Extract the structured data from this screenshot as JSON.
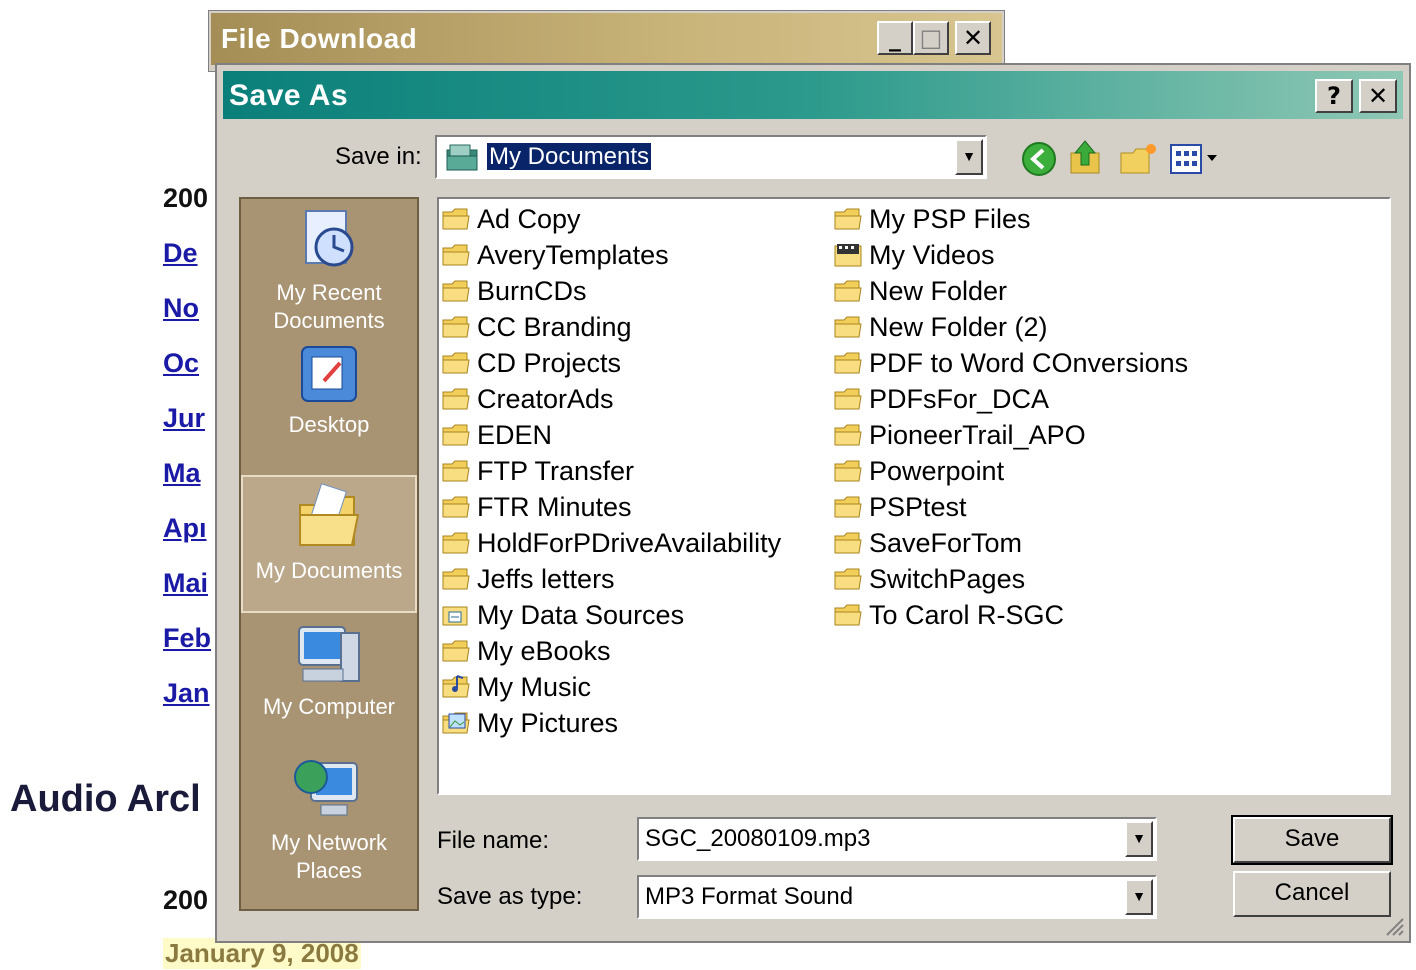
{
  "background_page": {
    "year_headers": [
      "200",
      "200"
    ],
    "month_links": [
      "De",
      "No",
      "Oc",
      "Jur",
      "Ma",
      "Apı",
      "Mai",
      "Feb",
      "Jan"
    ],
    "section_heading": "Audio Arcl",
    "date_item": "January 9, 2008"
  },
  "file_download_window": {
    "title": "File Download",
    "minimize": "_",
    "maximize": "□",
    "close": "✕"
  },
  "save_as_dialog": {
    "title": "Save As",
    "help_button": "?",
    "close_button": "✕",
    "save_in_label": "Save in:",
    "save_in_value": "My Documents",
    "places": [
      {
        "label": "My Recent Documents",
        "icon": "recent-documents-icon"
      },
      {
        "label": "Desktop",
        "icon": "desktop-icon"
      },
      {
        "label": "My Documents",
        "icon": "my-documents-icon"
      },
      {
        "label": "My Computer",
        "icon": "my-computer-icon"
      },
      {
        "label": "My Network Places",
        "icon": "network-places-icon"
      }
    ],
    "files_col1": [
      {
        "name": "Ad Copy",
        "icon": "folder-icon"
      },
      {
        "name": "AveryTemplates",
        "icon": "folder-icon"
      },
      {
        "name": "BurnCDs",
        "icon": "folder-icon"
      },
      {
        "name": "CC Branding",
        "icon": "folder-icon"
      },
      {
        "name": "CD Projects",
        "icon": "folder-icon"
      },
      {
        "name": "CreatorAds",
        "icon": "folder-icon"
      },
      {
        "name": "EDEN",
        "icon": "folder-icon"
      },
      {
        "name": "FTP Transfer",
        "icon": "folder-icon"
      },
      {
        "name": "FTR Minutes",
        "icon": "folder-icon"
      },
      {
        "name": "HoldForPDriveAvailability",
        "icon": "folder-icon"
      },
      {
        "name": "Jeffs letters",
        "icon": "folder-icon"
      },
      {
        "name": "My Data Sources",
        "icon": "data-sources-folder-icon"
      },
      {
        "name": "My eBooks",
        "icon": "folder-icon"
      },
      {
        "name": "My Music",
        "icon": "music-folder-icon"
      },
      {
        "name": "My Pictures",
        "icon": "pictures-folder-icon"
      }
    ],
    "files_col2": [
      {
        "name": "My PSP Files",
        "icon": "folder-icon"
      },
      {
        "name": "My Videos",
        "icon": "videos-folder-icon"
      },
      {
        "name": "New Folder",
        "icon": "folder-icon"
      },
      {
        "name": "New Folder (2)",
        "icon": "folder-icon"
      },
      {
        "name": "PDF to Word COnversions",
        "icon": "folder-icon"
      },
      {
        "name": "PDFsFor_DCA",
        "icon": "folder-icon"
      },
      {
        "name": "PioneerTrail_APO",
        "icon": "folder-icon"
      },
      {
        "name": "Powerpoint",
        "icon": "folder-icon"
      },
      {
        "name": "PSPtest",
        "icon": "folder-icon"
      },
      {
        "name": "SaveForTom",
        "icon": "folder-icon"
      },
      {
        "name": "SwitchPages",
        "icon": "folder-icon"
      },
      {
        "name": "To Carol R-SGC",
        "icon": "folder-icon"
      }
    ],
    "file_name_label": "File name:",
    "file_name_value": "SGC_20080109.mp3",
    "save_as_type_label": "Save as type:",
    "save_as_type_value": "MP3 Format Sound",
    "save_button": "Save",
    "cancel_button": "Cancel",
    "toolbar_icons": [
      "back-icon",
      "up-folder-icon",
      "new-folder-icon",
      "views-menu-icon"
    ]
  },
  "colors": {
    "file_download_title": "#b9a46a",
    "save_as_title": "#0a7f7a",
    "places_bar": "#a89373",
    "dialog_face": "#d4d0c8"
  }
}
